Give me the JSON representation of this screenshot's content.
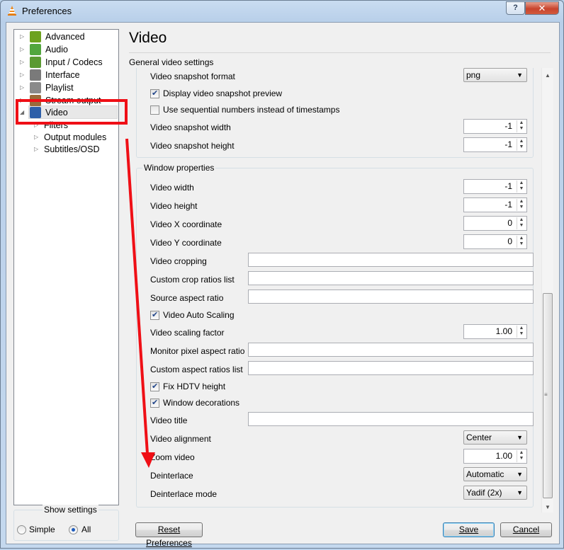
{
  "window": {
    "title": "Preferences",
    "help_label": "?",
    "close_label": "✕"
  },
  "tree": {
    "items": [
      {
        "label": "Advanced",
        "icon": "advanced-icon",
        "color": "#6da21f"
      },
      {
        "label": "Audio",
        "icon": "audio-icon",
        "color": "#52a63e"
      },
      {
        "label": "Input / Codecs",
        "icon": "codecs-icon",
        "color": "#5b9a32"
      },
      {
        "label": "Interface",
        "icon": "interface-icon",
        "color": "#7a7a7a"
      },
      {
        "label": "Playlist",
        "icon": "playlist-icon",
        "color": "#8a8a8a"
      },
      {
        "label": "Stream output",
        "icon": "stream-icon",
        "color": "#9a6a3a"
      },
      {
        "label": "Video",
        "icon": "video-icon",
        "color": "#2e5fa8"
      }
    ],
    "sub_items": [
      "Filters",
      "Output modules",
      "Subtitles/OSD"
    ]
  },
  "show_settings": {
    "label": "Show settings",
    "simple": "Simple",
    "all": "All",
    "selected": "All"
  },
  "main": {
    "heading": "Video",
    "section": "General video settings",
    "snapshot": {
      "format_label": "Video snapshot format",
      "format_value": "png",
      "preview_label": "Display video snapshot preview",
      "preview_checked": true,
      "sequential_label": "Use sequential numbers instead of timestamps",
      "sequential_checked": false,
      "width_label": "Video snapshot width",
      "width_value": "-1",
      "height_label": "Video snapshot height",
      "height_value": "-1"
    },
    "window_props": {
      "title": "Window properties",
      "video_width_label": "Video width",
      "video_width_value": "-1",
      "video_height_label": "Video height",
      "video_height_value": "-1",
      "x_label": "Video X coordinate",
      "x_value": "0",
      "y_label": "Video Y coordinate",
      "y_value": "0",
      "cropping_label": "Video cropping",
      "crop_ratios_label": "Custom crop ratios list",
      "source_aspect_label": "Source aspect ratio",
      "auto_scaling_label": "Video Auto Scaling",
      "auto_scaling_checked": true,
      "scaling_factor_label": "Video scaling factor",
      "scaling_factor_value": "1.00",
      "monitor_aspect_label": "Monitor pixel aspect ratio",
      "custom_aspect_label": "Custom aspect ratios list",
      "hdtv_label": "Fix HDTV height",
      "hdtv_checked": true,
      "decorations_label": "Window decorations",
      "decorations_checked": true,
      "video_title_label": "Video title",
      "alignment_label": "Video alignment",
      "alignment_value": "Center",
      "zoom_label": "Zoom video",
      "zoom_value": "1.00",
      "deinterlace_label": "Deinterlace",
      "deinterlace_value": "Automatic",
      "deinterlace_mode_label": "Deinterlace mode",
      "deinterlace_mode_value": "Yadif (2x)"
    }
  },
  "buttons": {
    "reset": "Reset Preferences",
    "save": "Save",
    "cancel": "Cancel"
  },
  "annotation": {
    "color": "#ef0f16"
  }
}
